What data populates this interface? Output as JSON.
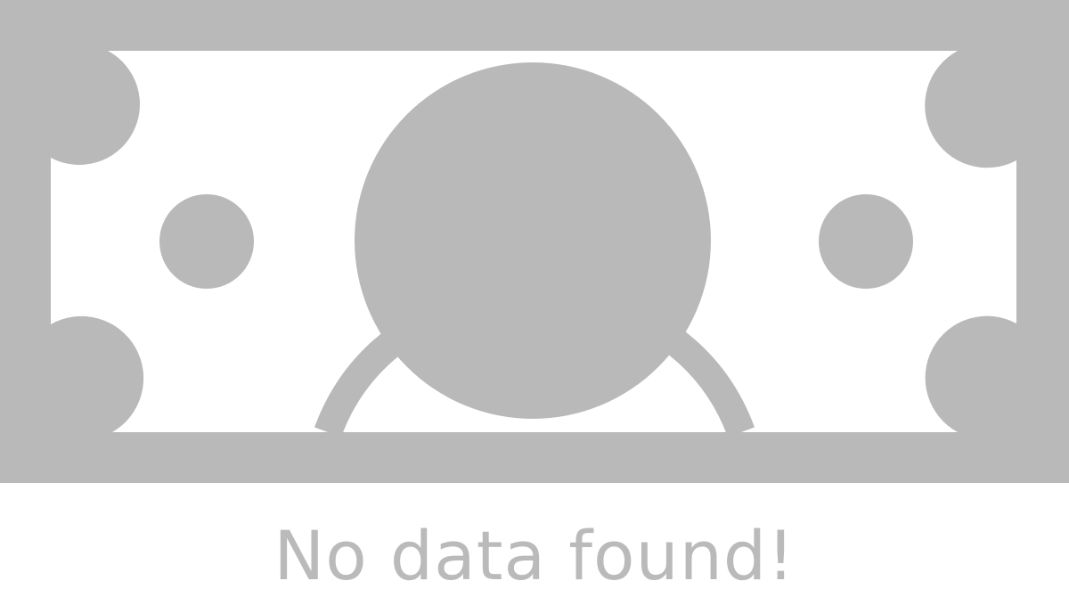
{
  "empty_state": {
    "icon": "money-bill-icon",
    "message": "No data found!"
  },
  "colors": {
    "illustration": "#b9b9b9",
    "background": "#ffffff",
    "message_text": "#bababa"
  }
}
